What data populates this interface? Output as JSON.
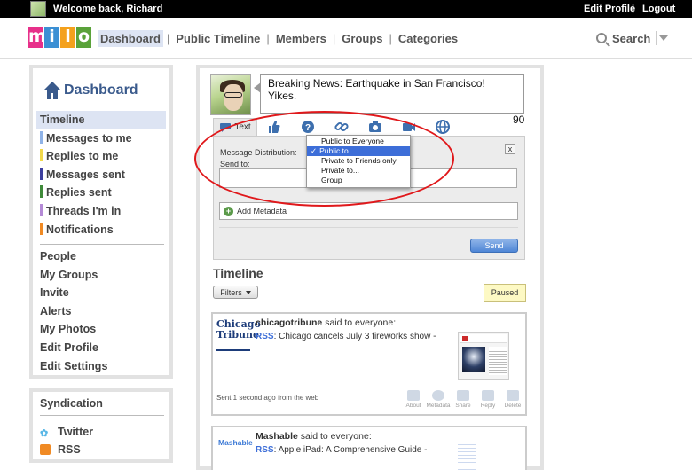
{
  "topbar": {
    "welcome": "Welcome back, Richard",
    "edit_profile": "Edit Profile",
    "separator": "|",
    "logout": "Logout"
  },
  "logo": {
    "letters": [
      "m",
      "i",
      "l",
      "o"
    ],
    "colors": [
      "#e7308a",
      "#3b8fd4",
      "#f4a11d",
      "#5aa23a"
    ]
  },
  "nav": {
    "items": [
      "Dashboard",
      "Public Timeline",
      "Members",
      "Groups",
      "Categories"
    ],
    "active": "Dashboard",
    "search": "Search"
  },
  "sidebar": {
    "title": "Dashboard",
    "items": [
      {
        "label": "Timeline",
        "color": ""
      },
      {
        "label": "Messages to me",
        "color": "#8fb3e8"
      },
      {
        "label": "Replies to me",
        "color": "#f1d84a"
      },
      {
        "label": "Messages sent",
        "color": "#3c3f9e"
      },
      {
        "label": "Replies sent",
        "color": "#3f8a3a"
      },
      {
        "label": "Threads I'm in",
        "color": "#b48ad6"
      },
      {
        "label": "Notifications",
        "color": "#f08a24"
      }
    ],
    "secondary": [
      "People",
      "My Groups",
      "Invite",
      "Alerts",
      "My Photos",
      "Edit Profile",
      "Edit Settings"
    ]
  },
  "syndication": {
    "title": "Syndication",
    "twitter": "Twitter",
    "rss": "RSS"
  },
  "composer": {
    "text": "Breaking News: Earthquake in San Francisco! Yikes.",
    "counter": "90",
    "active_tab": "Text",
    "tab_icons": [
      "thumbs-up-icon",
      "question-icon",
      "link-icon",
      "camera-icon",
      "video-icon",
      "globe-icon"
    ],
    "distribution_label": "Message Distribution:",
    "sendto_label": "Send to:",
    "close": "x",
    "add_metadata": "Add Metadata",
    "send": "Send",
    "dropdown": {
      "options": [
        "Public to Everyone",
        "Public to...",
        "Private to Friends only",
        "Private to...",
        "Group"
      ],
      "selected": "Public to..."
    }
  },
  "timeline": {
    "title": "Timeline",
    "filters": "Filters",
    "status": "Paused",
    "posts": [
      {
        "logo_text": "Chicago Tribune",
        "author": "chicagotribune",
        "audience": "said to everyone:",
        "source": "RSS",
        "text": "Chicago cancels July 3 fireworks show -",
        "meta": "Sent 1 second ago from the web",
        "actions": [
          "About",
          "Metadata",
          "Share",
          "Reply",
          "Delete"
        ]
      },
      {
        "logo_text": "Mashable",
        "author": "Mashable",
        "audience": "said to everyone:",
        "source": "RSS",
        "text": "Apple iPad: A Comprehensive Guide -"
      }
    ]
  },
  "colors": {
    "accent": "#3d6ed8",
    "annotation": "#e0181b",
    "paused_bg": "#fdf9c4"
  }
}
